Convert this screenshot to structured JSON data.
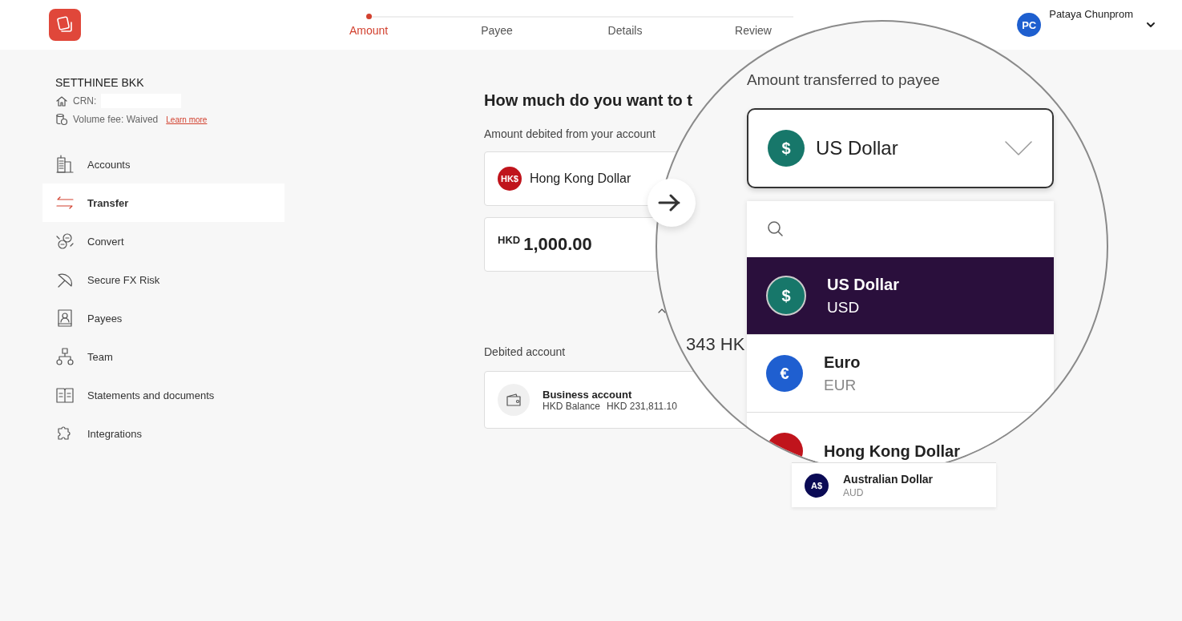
{
  "header": {
    "steps": [
      {
        "label": "Amount",
        "selected": true
      },
      {
        "label": "Payee",
        "selected": false
      },
      {
        "label": "Details",
        "selected": false
      },
      {
        "label": "Review",
        "selected": false
      }
    ],
    "user": {
      "initials": "PC",
      "name": "Pataya Chunprom"
    }
  },
  "sidebar": {
    "company": "SETTHINEE BKK",
    "crn_label": "CRN:",
    "volume_fee": "Volume fee: Waived",
    "learn_more": "Learn more",
    "items": [
      {
        "label": "Accounts",
        "kind": "building",
        "selected": false
      },
      {
        "label": "Transfer",
        "kind": "arrows",
        "selected": true
      },
      {
        "label": "Convert",
        "kind": "exchange",
        "selected": false
      },
      {
        "label": "Secure FX Risk",
        "kind": "umbrella",
        "selected": false
      },
      {
        "label": "Payees",
        "kind": "contact",
        "selected": false
      },
      {
        "label": "Team",
        "kind": "team",
        "selected": false
      },
      {
        "label": "Statements and documents",
        "kind": "book",
        "selected": false
      },
      {
        "label": "Integrations",
        "kind": "puzzle",
        "selected": false
      }
    ]
  },
  "main": {
    "title": "How much do you want to t",
    "debit_label": "Amount debited from your account",
    "debit_currency": {
      "name": "Hong Kong Dollar",
      "symbol": "HK$",
      "color": "#c0141c"
    },
    "amount": {
      "currency": "HKD",
      "value": "1,000.00"
    },
    "rate_fragment": "343 HK",
    "debited_account_label": "Debited account",
    "account": {
      "name": "Business account",
      "balance_label": "HKD Balance",
      "balance": "HKD 231,811.10"
    }
  },
  "magnifier": {
    "payee_label": "Amount transferred to payee",
    "selected_currency": {
      "name": "US Dollar",
      "symbol": "$",
      "color": "#17776a"
    },
    "options": [
      {
        "name": "US Dollar",
        "code": "USD",
        "symbol": "$",
        "color": "#17776a",
        "selected": true
      },
      {
        "name": "Euro",
        "code": "EUR",
        "symbol": "€",
        "color": "#1f5fd0",
        "selected": false
      },
      {
        "name": "Hong Kong Dollar",
        "color": "#c0141c",
        "selected": false
      }
    ]
  },
  "dropdown_below": {
    "options": [
      {
        "name": "Australian Dollar",
        "code": "AUD",
        "symbol": "A$",
        "color": "#0b0b55",
        "selected": false
      }
    ]
  }
}
